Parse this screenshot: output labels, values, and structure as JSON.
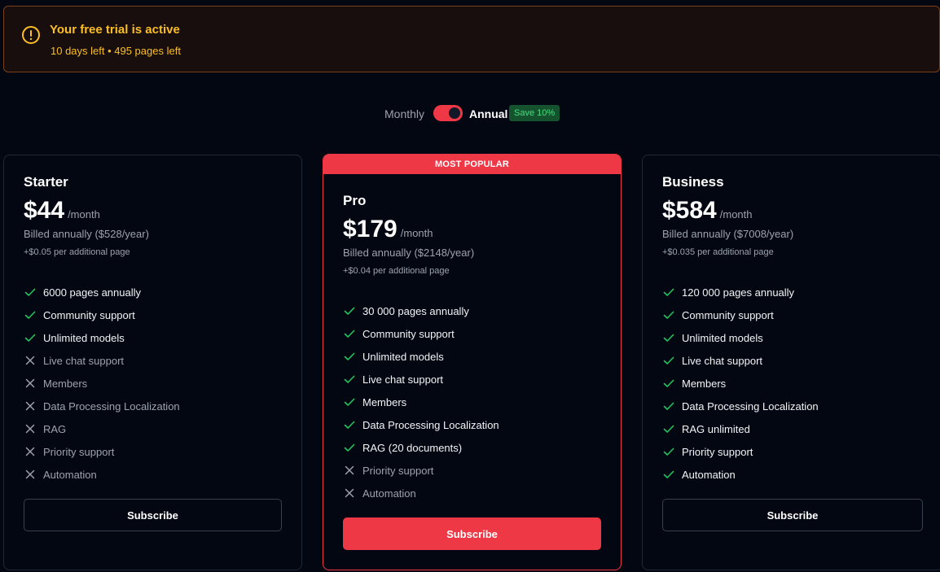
{
  "trial": {
    "icon": "warning-circle-icon",
    "title": "Your free trial is active",
    "subtitle": "10 days left • 495 pages left",
    "color": "#fbbf24"
  },
  "billing": {
    "monthly_label": "Monthly",
    "annual_label": "Annual",
    "save_badge": "Save 10%",
    "selected": "Annual"
  },
  "colors": {
    "accent": "#ef3846",
    "background": "#030712",
    "check": "#22c55e",
    "cross": "#9ca3af"
  },
  "plans": [
    {
      "name": "Starter",
      "price": "$44",
      "per": "/month",
      "billed": "Billed annually ($528/year)",
      "extra": "+$0.05 per additional page",
      "subscribe_label": "Subscribe",
      "features": [
        {
          "label": "6000 pages annually",
          "included": true
        },
        {
          "label": "Community support",
          "included": true
        },
        {
          "label": "Unlimited models",
          "included": true
        },
        {
          "label": "Live chat support",
          "included": false
        },
        {
          "label": "Members",
          "included": false
        },
        {
          "label": "Data Processing Localization",
          "included": false
        },
        {
          "label": "RAG",
          "included": false
        },
        {
          "label": "Priority support",
          "included": false
        },
        {
          "label": "Automation",
          "included": false
        }
      ]
    },
    {
      "name": "Pro",
      "ribbon": "MOST POPULAR",
      "price": "$179",
      "per": "/month",
      "billed": "Billed annually ($2148/year)",
      "extra": "+$0.04 per additional page",
      "subscribe_label": "Subscribe",
      "features": [
        {
          "label": "30 000 pages annually",
          "included": true
        },
        {
          "label": "Community support",
          "included": true
        },
        {
          "label": "Unlimited models",
          "included": true
        },
        {
          "label": "Live chat support",
          "included": true
        },
        {
          "label": "Members",
          "included": true
        },
        {
          "label": "Data Processing Localization",
          "included": true
        },
        {
          "label": "RAG (20 documents)",
          "included": true
        },
        {
          "label": "Priority support",
          "included": false
        },
        {
          "label": "Automation",
          "included": false
        }
      ]
    },
    {
      "name": "Business",
      "price": "$584",
      "per": "/month",
      "billed": "Billed annually ($7008/year)",
      "extra": "+$0.035 per additional page",
      "subscribe_label": "Subscribe",
      "features": [
        {
          "label": "120 000 pages annually",
          "included": true
        },
        {
          "label": "Community support",
          "included": true
        },
        {
          "label": "Unlimited models",
          "included": true
        },
        {
          "label": "Live chat support",
          "included": true
        },
        {
          "label": "Members",
          "included": true
        },
        {
          "label": "Data Processing Localization",
          "included": true
        },
        {
          "label": "RAG unlimited",
          "included": true
        },
        {
          "label": "Priority support",
          "included": true
        },
        {
          "label": "Automation",
          "included": true
        }
      ]
    }
  ]
}
